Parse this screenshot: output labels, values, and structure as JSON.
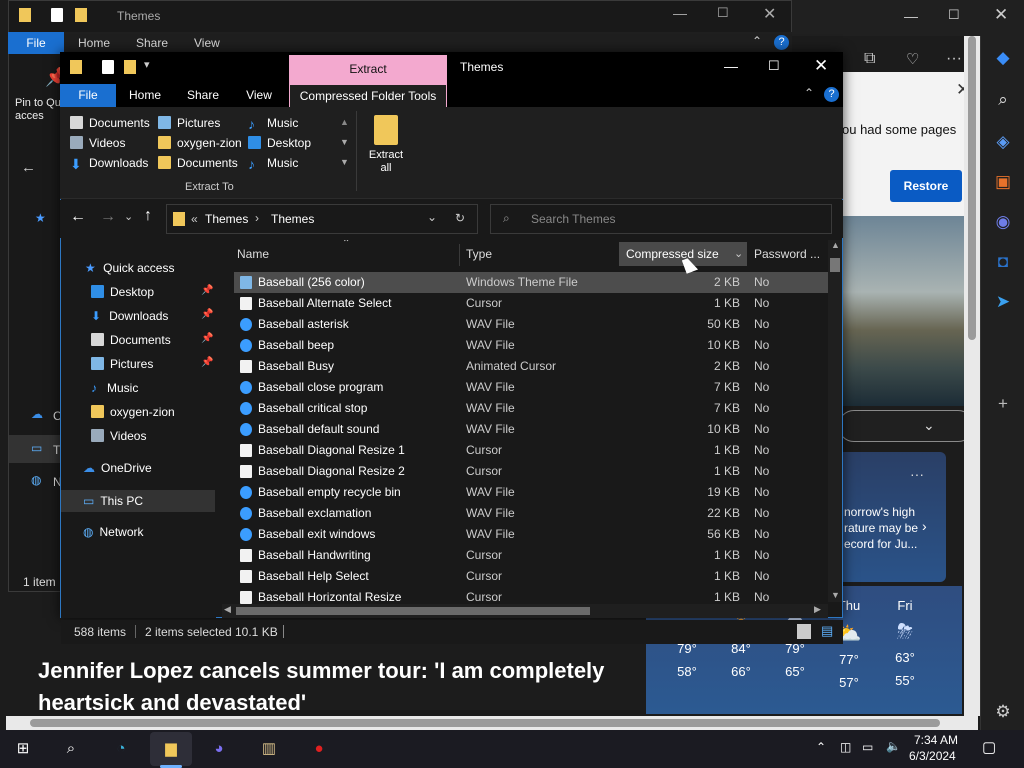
{
  "edge": {
    "restore_text": "ou had some pages",
    "restore_button": "Restore",
    "weather_card_text": "norrow's high rature may be ecord for Ju...",
    "forecast": [
      {
        "day": "",
        "high": "79°",
        "low": "58°"
      },
      {
        "day": "",
        "high": "84°",
        "low": "66°"
      },
      {
        "day": "",
        "high": "79°",
        "low": "65°"
      },
      {
        "day": "Thu",
        "high": "77°",
        "low": "57°"
      },
      {
        "day": "Fri",
        "high": "63°",
        "low": "55°"
      }
    ],
    "news_title": "Jennifer Lopez cancels summer tour: 'I am completely heartsick and devastated'"
  },
  "back_window": {
    "title": "Themes",
    "tabs": [
      "File",
      "Home",
      "Share",
      "View"
    ],
    "pin_label": "Pin to Qu acces",
    "status": "1 item",
    "nav_labels": [
      "C",
      "T",
      "N"
    ]
  },
  "window": {
    "title": "Themes",
    "context_group": "Extract",
    "tabs": [
      "File",
      "Home",
      "Share",
      "View",
      "Compressed Folder Tools"
    ],
    "extract_to": {
      "label": "Extract To",
      "items": [
        {
          "label": "Documents",
          "icon": "documents-icon"
        },
        {
          "label": "Pictures",
          "icon": "pictures-icon"
        },
        {
          "label": "Music",
          "icon": "music-icon"
        },
        {
          "label": "Videos",
          "icon": "videos-icon"
        },
        {
          "label": "oxygen-zion",
          "icon": "folder-icon"
        },
        {
          "label": "Desktop",
          "icon": "desktop-icon"
        },
        {
          "label": "Downloads",
          "icon": "downloads-icon"
        },
        {
          "label": "Documents",
          "icon": "documents-icon"
        },
        {
          "label": "Music",
          "icon": "music-icon"
        }
      ]
    },
    "extract_all": "Extract all",
    "breadcrumb": [
      "Themes",
      "Themes"
    ],
    "breadcrumb_prefix": "«",
    "search_placeholder": "Search Themes",
    "nav": [
      {
        "label": "Quick access",
        "icon": "star-icon",
        "pinned": false
      },
      {
        "label": "Desktop",
        "icon": "desktop-icon",
        "pinned": true
      },
      {
        "label": "Downloads",
        "icon": "downloads-icon",
        "pinned": true
      },
      {
        "label": "Documents",
        "icon": "documents-icon",
        "pinned": true
      },
      {
        "label": "Pictures",
        "icon": "pictures-icon",
        "pinned": true
      },
      {
        "label": "Music",
        "icon": "music-icon",
        "pinned": false
      },
      {
        "label": "oxygen-zion",
        "icon": "folder-icon",
        "pinned": false
      },
      {
        "label": "Videos",
        "icon": "videos-icon",
        "pinned": false
      },
      {
        "label": "OneDrive",
        "icon": "cloud-icon",
        "pinned": false
      },
      {
        "label": "This PC",
        "icon": "pc-icon",
        "pinned": false
      },
      {
        "label": "Network",
        "icon": "network-icon",
        "pinned": false
      }
    ],
    "columns": [
      "Name",
      "Type",
      "Compressed size",
      "Password ..."
    ],
    "files": [
      {
        "name": "Baseball (256 color)",
        "type": "Windows Theme File",
        "size": "2 KB",
        "password": "No",
        "kind": "theme"
      },
      {
        "name": "Baseball Alternate Select",
        "type": "Cursor",
        "size": "1 KB",
        "password": "No",
        "kind": "cursor"
      },
      {
        "name": "Baseball asterisk",
        "type": "WAV File",
        "size": "50 KB",
        "password": "No",
        "kind": "wav"
      },
      {
        "name": "Baseball beep",
        "type": "WAV File",
        "size": "10 KB",
        "password": "No",
        "kind": "wav"
      },
      {
        "name": "Baseball Busy",
        "type": "Animated Cursor",
        "size": "2 KB",
        "password": "No",
        "kind": "cursor"
      },
      {
        "name": "Baseball close program",
        "type": "WAV File",
        "size": "7 KB",
        "password": "No",
        "kind": "wav"
      },
      {
        "name": "Baseball critical stop",
        "type": "WAV File",
        "size": "7 KB",
        "password": "No",
        "kind": "wav"
      },
      {
        "name": "Baseball default sound",
        "type": "WAV File",
        "size": "10 KB",
        "password": "No",
        "kind": "wav"
      },
      {
        "name": "Baseball Diagonal Resize 1",
        "type": "Cursor",
        "size": "1 KB",
        "password": "No",
        "kind": "cursor"
      },
      {
        "name": "Baseball Diagonal Resize 2",
        "type": "Cursor",
        "size": "1 KB",
        "password": "No",
        "kind": "cursor"
      },
      {
        "name": "Baseball empty recycle bin",
        "type": "WAV File",
        "size": "19 KB",
        "password": "No",
        "kind": "wav"
      },
      {
        "name": "Baseball exclamation",
        "type": "WAV File",
        "size": "22 KB",
        "password": "No",
        "kind": "wav"
      },
      {
        "name": "Baseball exit windows",
        "type": "WAV File",
        "size": "56 KB",
        "password": "No",
        "kind": "wav"
      },
      {
        "name": "Baseball Handwriting",
        "type": "Cursor",
        "size": "1 KB",
        "password": "No",
        "kind": "cursor"
      },
      {
        "name": "Baseball Help Select",
        "type": "Cursor",
        "size": "1 KB",
        "password": "No",
        "kind": "cursor"
      },
      {
        "name": "Baseball Horizontal Resize",
        "type": "Cursor",
        "size": "1 KB",
        "password": "No",
        "kind": "cursor"
      }
    ],
    "status": {
      "count": "588 items",
      "selected": "2 items selected",
      "size": "10.1 KB"
    }
  },
  "taskbar": {
    "time": "7:34 AM",
    "date": "6/3/2024"
  }
}
